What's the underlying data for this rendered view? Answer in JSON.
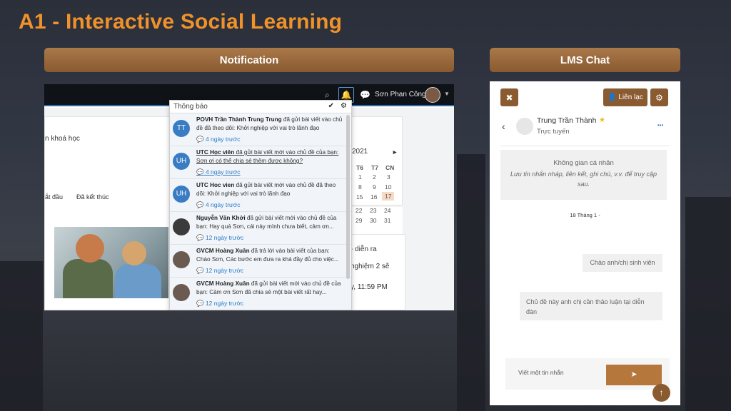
{
  "slide": {
    "title": "A1 - Interactive Social Learning",
    "left_header": "Notification",
    "right_header": "LMS Chat"
  },
  "navbar": {
    "user_name": "Sơn Phan Công",
    "icons": [
      "search-icon",
      "bell-icon",
      "chat-icon",
      "chevron-down-icon"
    ]
  },
  "page": {
    "courses_label": "n khoá học",
    "tab_started": "ắt đầu",
    "tab_finished": "Đã kết thúc",
    "right_snippet1": "- diễn ra",
    "right_snippet2": "nghiệm 2 sẽ",
    "right_snippet3": "y, 11:59 PM"
  },
  "calendar": {
    "year": "2021",
    "next": "►",
    "headers": [
      "T6",
      "T7",
      "CN"
    ],
    "rows": [
      [
        "1",
        "2",
        "3"
      ],
      [
        "8",
        "9",
        "10"
      ],
      [
        "15",
        "16",
        "17"
      ],
      [
        "22",
        "23",
        "24"
      ],
      [
        "29",
        "30",
        "31"
      ]
    ],
    "today": "17"
  },
  "notifications": {
    "title": "Thông báo",
    "items": [
      {
        "avatar": "TT",
        "name": "POVH Trần Thành Trung Trung",
        "text": " đã gửi bài viết vào chủ đề đã theo dõi: Khởi nghiệp với vai trò lãnh đạo",
        "time": "4 ngày trước"
      },
      {
        "avatar": "UH",
        "name": "UTC Học viên",
        "text": " đã gửi bài viết mới vào chủ đề của bạn: Sơn ơi có thể chia sẻ thêm được không?",
        "time": "4 ngày trước"
      },
      {
        "avatar": "UH",
        "name": "UTC Hoc vien",
        "text": " đã gửi bài viết mới vào chủ đề đã theo dõi: Khởi nghiệp với vai trò lãnh đạo",
        "time": "4 ngày trước"
      },
      {
        "avatar": "",
        "name": "Nguyễn Văn Khởi",
        "text": " đã gửi bài viết mới vào chủ đề của bạn: Hay quá Sơn, cái này mình chưa biết, cảm ơn...",
        "time": "12 ngày trước"
      },
      {
        "avatar": "",
        "name": "GVCM Hoàng Xuân",
        "text": " đã trả lời vào bài viết của bạn: Chào Sơn, Các bước em đưa ra khá đầy đủ cho việc...",
        "time": "12 ngày trước"
      },
      {
        "avatar": "",
        "name": "GVCM Hoàng Xuân",
        "text": " đã gửi bài viết mới vào chủ đề của bạn: Cảm ơn Sơn đã chia sẻ một bài viết rất hay...",
        "time": "12 ngày trước"
      }
    ]
  },
  "chat": {
    "contact_button": "Liên lạc",
    "contact_name": "Trung Trần Thành",
    "status": "Trực tuyến",
    "private_title": "Không gian cá nhân",
    "private_desc": "Lưu tin nhắn nháp, liên kết, ghi chú, v.v. để truy cập sau.",
    "date": "18 Tháng 1 -",
    "msg1": "Chào anh/chị sinh viên",
    "msg2": "Chủ đề này anh chị cần thảo luận tại diễn đàn",
    "input_placeholder": "Viết một tin nhắn",
    "more": "•••"
  },
  "colors": {
    "accent": "#f0922a",
    "brown": "#8a5a30",
    "link": "#2a7dc9"
  }
}
